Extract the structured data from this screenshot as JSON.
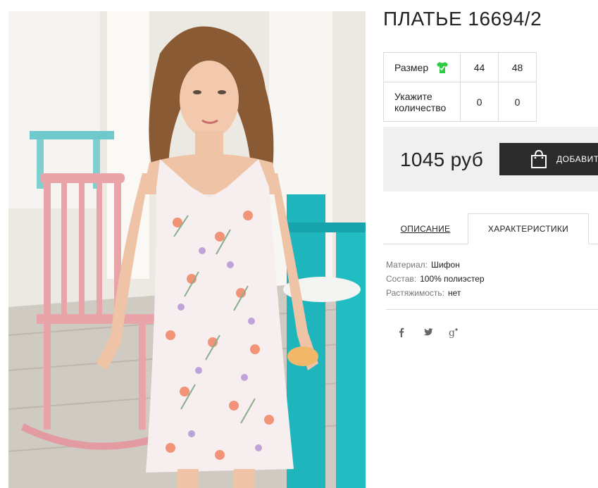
{
  "product": {
    "title": "ПЛАТЬЕ 16694/2",
    "photo_alt": "product-photo"
  },
  "sizes": {
    "label": "Размер",
    "values": [
      "44",
      "48"
    ],
    "quantity_label_line1": "Укажите",
    "quantity_label_line2": "количество",
    "quantities": [
      "0",
      "0"
    ],
    "icon": "shirt-check-icon",
    "icon_color": "#2ecc40"
  },
  "purchase": {
    "price": "1045 руб",
    "add_button_label": "ДОБАВИТЬ",
    "icon": "shopping-bag-icon"
  },
  "tabs": [
    {
      "label": "ОПИСАНИЕ",
      "active": false
    },
    {
      "label": "ХАРАКТЕРИСТИКИ",
      "active": true
    }
  ],
  "specs": [
    {
      "key": "Материал:",
      "value": "Шифон"
    },
    {
      "key": "Состав:",
      "value": "100% полиэстер"
    },
    {
      "key": "Растяжимость:",
      "value": "нет"
    }
  ],
  "social": [
    {
      "name": "facebook-icon",
      "glyph": "f"
    },
    {
      "name": "twitter-icon",
      "glyph": "t"
    },
    {
      "name": "google-plus-icon",
      "glyph": "g+"
    }
  ],
  "colors": {
    "accent_dark": "#2b2b2b",
    "panel_bg": "#f0f0f0",
    "border": "#dcdcdc"
  }
}
